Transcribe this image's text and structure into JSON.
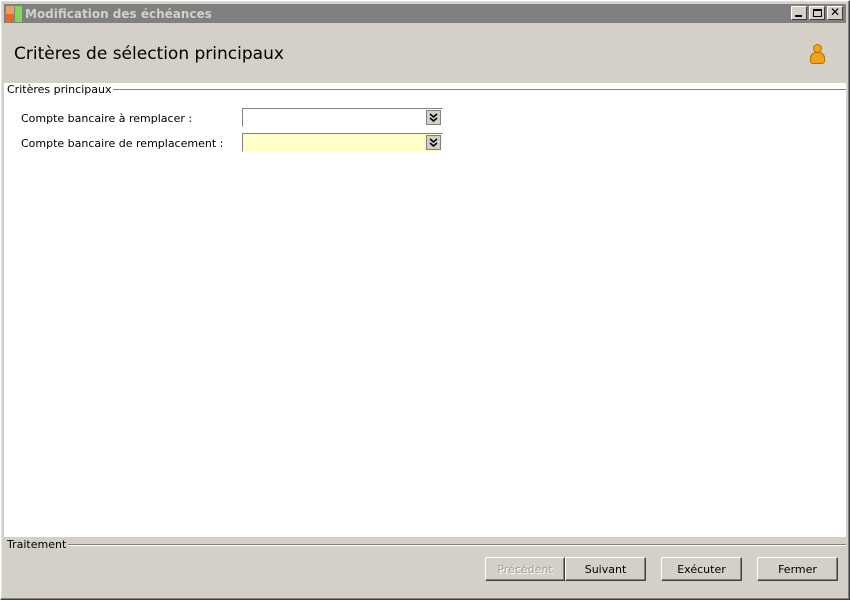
{
  "window": {
    "title": "Modification des échéances"
  },
  "header": {
    "title": "Critères de sélection principaux",
    "user_icon": "user-icon"
  },
  "criteria": {
    "legend": "Critères principaux",
    "fields": [
      {
        "label": "Compte bancaire à remplacer :",
        "value": ""
      },
      {
        "label": "Compte bancaire de remplacement :",
        "value": ""
      }
    ]
  },
  "processing": {
    "legend": "Traitement",
    "buttons": {
      "previous": "Précédent",
      "next": "Suivant",
      "execute": "Exécuter",
      "close": "Fermer"
    }
  },
  "colors": {
    "highlight_field": "#ffffc8",
    "user_icon": "#f3a31a"
  }
}
